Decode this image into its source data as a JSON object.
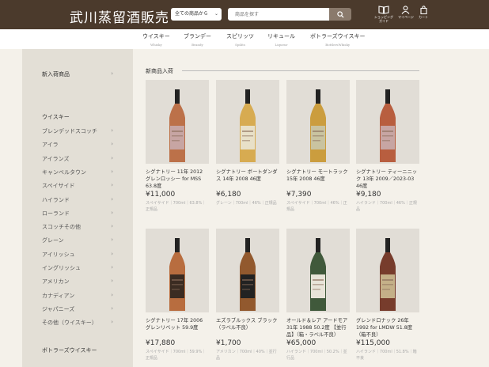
{
  "header": {
    "logo": "武川蒸留酒販売",
    "category_select": "全ての商品から",
    "search_placeholder": "商品を探す",
    "icons": [
      {
        "name": "shopping-guide-icon",
        "label1": "ショッピング",
        "label2": "ガイド"
      },
      {
        "name": "user-icon",
        "label1": "マイページ",
        "label2": ""
      },
      {
        "name": "cart-icon",
        "label1": "カート",
        "label2": ""
      }
    ]
  },
  "nav": [
    {
      "jp": "ウイスキー",
      "en": "Whisky"
    },
    {
      "jp": "ブランデー",
      "en": "Brandy"
    },
    {
      "jp": "スピリッツ",
      "en": "Spilits"
    },
    {
      "jp": "リキュール",
      "en": "Liqueur"
    },
    {
      "jp": "ボトラーズウイスキー",
      "en": "BottlersWhisky"
    }
  ],
  "sidebar": {
    "new_arrivals": "新入荷商品",
    "whisky_heading": "ウイスキー",
    "whisky_items": [
      "ブレンデッドスコッチ",
      "アイラ",
      "アイランズ",
      "キャンベルタウン",
      "スペイサイド",
      "ハイランド",
      "ローランド",
      "スコッチその他",
      "グレーン",
      "アイリッシュ",
      "イングリッシュ",
      "アメリカン",
      "カナディアン",
      "ジャパニーズ",
      "その他（ウイスキー）"
    ],
    "bottlers_heading": "ボトラーズウイスキー"
  },
  "main": {
    "section_title": "新商品入荷",
    "products": [
      {
        "name": "シグナトリー 11年 2012 グレンロッシー for MSS 63.8度",
        "price": "¥11,000",
        "desc": "スペイサイド｜700ml｜63.8%｜正規品",
        "label_color": "#c7a5a3",
        "liquid": "#b8653a"
      },
      {
        "name": "シグナトリー ボートダンダス 14年 2008 46度",
        "price": "¥6,180",
        "desc": "グレーン｜700ml｜46%｜正規品",
        "label_color": "#e8e0c8",
        "liquid": "#d6a543"
      },
      {
        "name": "シグナトリー モートラック 15年 2008 46度",
        "price": "¥7,390",
        "desc": "スペイサイド｜700ml｜46%｜正規品",
        "label_color": "#c9c3a0",
        "liquid": "#c9962e"
      },
      {
        "name": "シグナトリー ティーニニック 13年 2009／2023-03 46度",
        "price": "¥9,180",
        "desc": "ハイランド｜700ml｜46%｜正規品",
        "label_color": "#c7a5a3",
        "liquid": "#b4502f"
      },
      {
        "name": "シグナトリー 17年 2006 グレンリベット 59.9度",
        "price": "¥17,880",
        "desc": "スペイサイド｜700ml｜59.9%｜正規品",
        "label_color": "#3b2c22",
        "liquid": "#b4602f"
      },
      {
        "name": "エズラブルックス ブラック（ラベル不良）",
        "price": "¥1,700",
        "desc": "アメリカン｜700ml｜40%｜並行品",
        "label_color": "#222222",
        "liquid": "#8a4a1c"
      },
      {
        "name": "オールド＆レア アードモア 31年 1988 50.2度 【並行品】（箱・ラベル不良）",
        "price": "¥65,000",
        "desc": "ハイランド｜700ml｜50.2%｜並行品",
        "label_color": "#e8e4d8",
        "liquid": "#2f4a2a"
      },
      {
        "name": "グレンドロナック 26年 1992 for LMDW 51.8度 （箱不良）",
        "price": "¥115,000",
        "desc": "ハイランド｜700ml｜51.8%｜箱不良",
        "label_color": "#c4b088",
        "liquid": "#6b2a1a"
      }
    ]
  }
}
